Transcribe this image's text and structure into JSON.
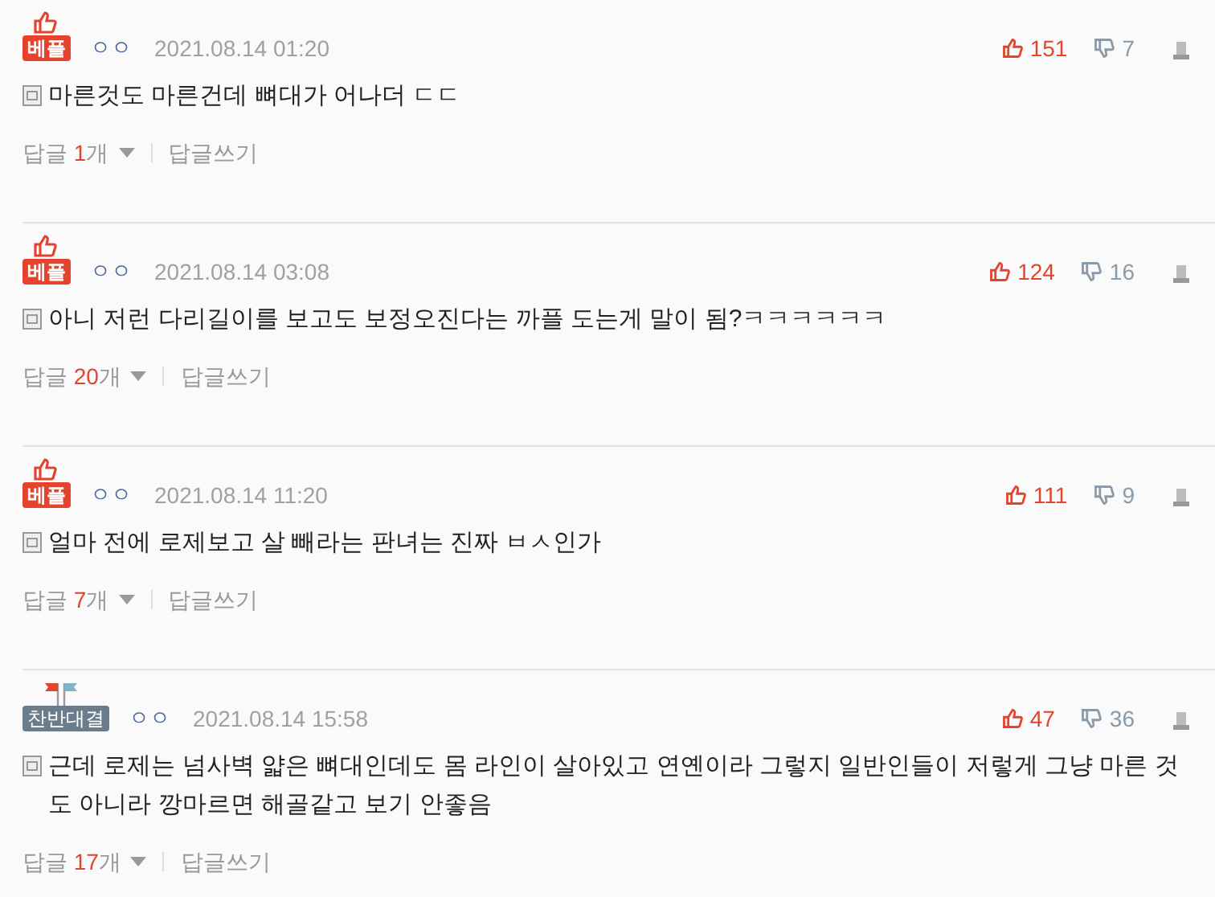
{
  "comments": [
    {
      "badge": {
        "kind": "best",
        "label": "베플"
      },
      "user": "ㅇㅇ",
      "date": "2021.08.14 01:20",
      "likes": "151",
      "dislikes": "7",
      "text": "마른것도 마른건데 뼈대가 어나더 ㄷㄷ",
      "reply_label": "답글",
      "reply_count": "1",
      "reply_unit": "개",
      "write_reply": "답글쓰기"
    },
    {
      "badge": {
        "kind": "best",
        "label": "베플"
      },
      "user": "ㅇㅇ",
      "date": "2021.08.14 03:08",
      "likes": "124",
      "dislikes": "16",
      "text": "아니 저런 다리길이를 보고도 보정오진다는 까플 도는게 말이 됨?ㅋㅋㅋㅋㅋㅋ",
      "reply_label": "답글",
      "reply_count": "20",
      "reply_unit": "개",
      "write_reply": "답글쓰기"
    },
    {
      "badge": {
        "kind": "best",
        "label": "베플"
      },
      "user": "ㅇㅇ",
      "date": "2021.08.14 11:20",
      "likes": "111",
      "dislikes": "9",
      "text": "얼마 전에 로제보고 살 빼라는 판녀는 진짜 ㅂㅅ인가",
      "reply_label": "답글",
      "reply_count": "7",
      "reply_unit": "개",
      "write_reply": "답글쓰기"
    },
    {
      "badge": {
        "kind": "debate",
        "label": "찬반대결"
      },
      "user": "ㅇㅇ",
      "date": "2021.08.14 15:58",
      "likes": "47",
      "dislikes": "36",
      "text": "근데 로제는 넘사벽 얇은 뼈대인데도 몸 라인이 살아있고 연옌이라 그렇지 일반인들이 저렇게 그냥 마른 것도 아니라 깡마르면 해골같고 보기 안좋음",
      "reply_label": "답글",
      "reply_count": "17",
      "reply_unit": "개",
      "write_reply": "답글쓰기"
    }
  ]
}
